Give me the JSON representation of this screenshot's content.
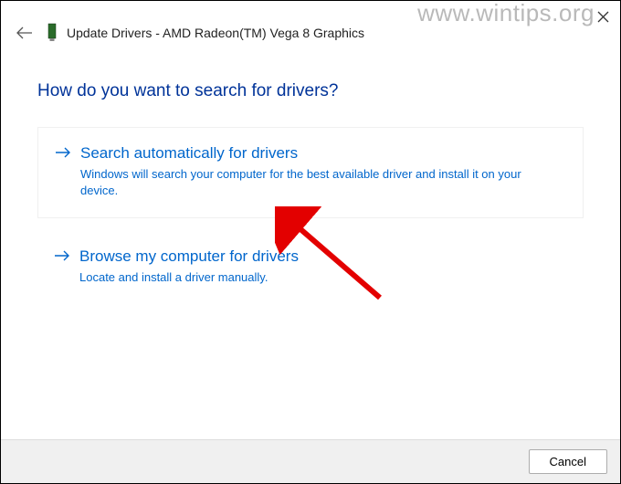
{
  "watermark": "www.wintips.org",
  "header": {
    "title": "Update Drivers - AMD Radeon(TM) Vega 8 Graphics"
  },
  "question": "How do you want to search for drivers?",
  "options": {
    "auto": {
      "title": "Search automatically for drivers",
      "desc": "Windows will search your computer for the best available driver and install it on your device."
    },
    "browse": {
      "title": "Browse my computer for drivers",
      "desc": "Locate and install a driver manually."
    }
  },
  "footer": {
    "cancel": "Cancel"
  }
}
